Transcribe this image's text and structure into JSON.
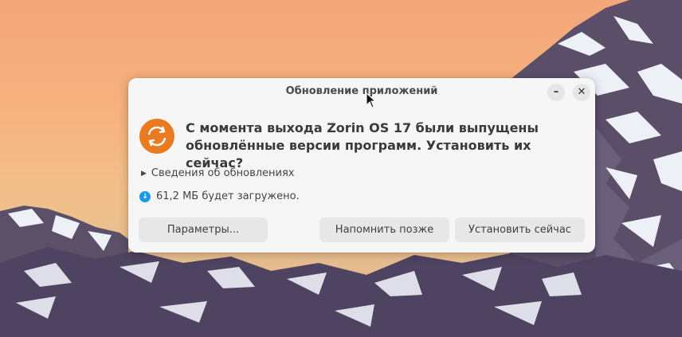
{
  "desktop": {
    "sky_top": "#f4a77a",
    "sky_bottom": "#e9c08f",
    "mountain": "#5b4f69",
    "snow": "#eef0f7"
  },
  "dialog": {
    "title": "Обновление приложений",
    "minimize_icon": "minimize-icon",
    "close_icon": "close-icon",
    "app_icon": "update-arrows-icon",
    "app_icon_color": "#ea7a20",
    "headline": "С момента выхода Zorin OS 17 были выпущены обновлённые версии программ. Установить их сейчас?",
    "details_label": "Сведения об обновлениях",
    "download_icon": "download-icon",
    "download_icon_color": "#1b9be6",
    "download_size": "61,2 МБ будет загружено.",
    "buttons": {
      "params": "Параметры...",
      "remind": "Напомнить позже",
      "install": "Установить сейчас"
    }
  }
}
